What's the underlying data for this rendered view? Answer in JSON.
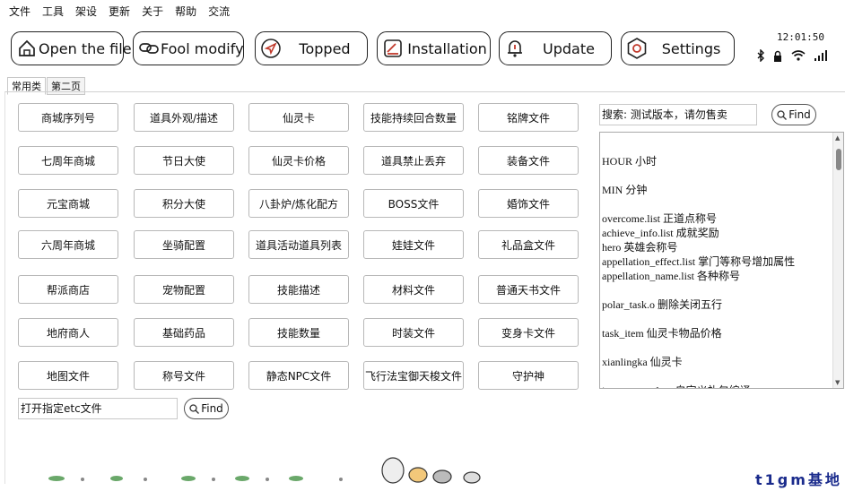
{
  "menu": [
    "文件",
    "工具",
    "架设",
    "更新",
    "关于",
    "帮助",
    "交流"
  ],
  "toolbar": [
    {
      "label": "Open the file",
      "icon": "home-icon"
    },
    {
      "label": "Fool modify",
      "icon": "link-icon"
    },
    {
      "label": "Topped",
      "icon": "navigation-icon"
    },
    {
      "label": "Installation",
      "icon": "install-icon"
    },
    {
      "label": "Update",
      "icon": "bell-icon"
    },
    {
      "label": "Settings",
      "icon": "settings-icon"
    }
  ],
  "status": {
    "time": "12:01:50",
    "icons": [
      "bluetooth-icon",
      "lock-icon",
      "wifi-icon",
      "signal-icon"
    ]
  },
  "tabs": [
    "常用类",
    "第二页"
  ],
  "grid": [
    [
      "商城序列号",
      "道具外观/描述",
      "仙灵卡",
      "技能持续回合数量",
      "铭牌文件"
    ],
    [
      "七周年商城",
      "节日大使",
      "仙灵卡价格",
      "道具禁止丢弃",
      "装备文件"
    ],
    [
      "元宝商城",
      "积分大使",
      "八卦炉/炼化配方",
      "BOSS文件",
      "婚饰文件"
    ],
    [
      "六周年商城",
      "坐骑配置",
      "道具活动道具列表",
      "娃娃文件",
      "礼品盒文件"
    ],
    [
      "帮派商店",
      "宠物配置",
      "技能描述",
      "材料文件",
      "普通天书文件"
    ],
    [
      "地府商人",
      "基础药品",
      "技能数量",
      "时装文件",
      "变身卡文件"
    ],
    [
      "地图文件",
      "称号文件",
      "静态NPC文件",
      "飞行法宝御天梭文件",
      "守护神"
    ]
  ],
  "search": {
    "label": "搜索: 测试版本，请勿售卖",
    "find_label": "Find"
  },
  "textbox_lines": [
    "",
    "HOUR 小时",
    "",
    "MIN  分钟",
    "",
    "overcome.list 正道点称号",
    "achieve_info.list 成就奖励",
    "hero  英雄会称号",
    "appellation_effect.list 掌门等称号增加属性",
    "appellation_name.list   各种称号",
    "",
    "polar_task.o   删除关闭五行",
    "",
    "task_item  仙灵卡物品价格",
    "",
    "xianlingka  仙灵卡",
    "",
    "item_temp_desc    自定义礼包编译"
  ],
  "etc": {
    "label": "打开指定etc文件",
    "find_label": "Find"
  },
  "brand": "t1gm基地",
  "colors": {
    "brand": "#1a2b8c",
    "button_border": "#222222"
  }
}
